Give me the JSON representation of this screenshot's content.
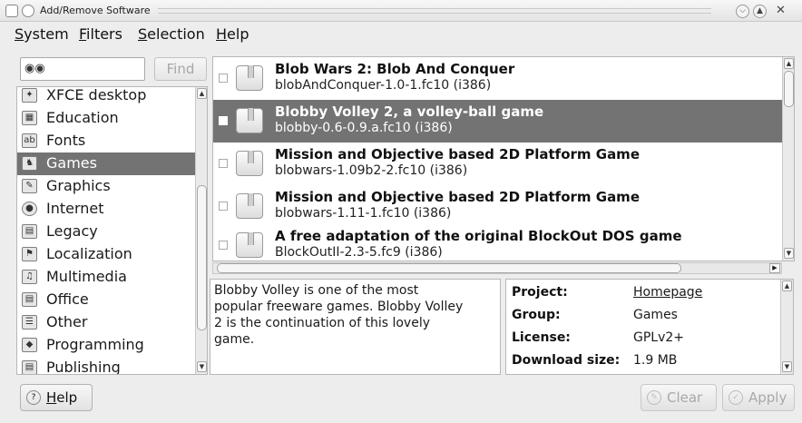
{
  "window": {
    "title": "Add/Remove Software"
  },
  "menubar": {
    "items": [
      {
        "label": "System",
        "mnemonic": "S",
        "rest": "ystem"
      },
      {
        "label": "Filters",
        "mnemonic": "F",
        "rest": "ilters"
      },
      {
        "label": "Selection",
        "mnemonic": "S",
        "rest": "election"
      },
      {
        "label": "Help",
        "mnemonic": "H",
        "rest": "elp"
      }
    ]
  },
  "search": {
    "value": "",
    "find_label": "Find"
  },
  "groups": {
    "items": [
      {
        "label": "XFCE desktop",
        "icon": "mouse-icon"
      },
      {
        "label": "Education",
        "icon": "education-icon"
      },
      {
        "label": "Fonts",
        "icon": "fonts-icon"
      },
      {
        "label": "Games",
        "icon": "games-icon",
        "selected": true
      },
      {
        "label": "Graphics",
        "icon": "graphics-icon"
      },
      {
        "label": "Internet",
        "icon": "internet-icon"
      },
      {
        "label": "Legacy",
        "icon": "legacy-icon"
      },
      {
        "label": "Localization",
        "icon": "flag-icon"
      },
      {
        "label": "Multimedia",
        "icon": "multimedia-icon"
      },
      {
        "label": "Office",
        "icon": "office-icon"
      },
      {
        "label": "Other",
        "icon": "other-icon"
      },
      {
        "label": "Programming",
        "icon": "programming-icon"
      },
      {
        "label": "Publishing",
        "icon": "publishing-icon"
      }
    ]
  },
  "packages": [
    {
      "name": "Blob Wars 2: Blob And Conquer",
      "version": "blobAndConquer-1.0-1.fc10 (i386)",
      "selected": false
    },
    {
      "name": "Blobby Volley 2, a volley-ball game",
      "version": "blobby-0.6-0.9.a.fc10 (i386)",
      "selected": true
    },
    {
      "name": "Mission and Objective based 2D Platform Game",
      "version": "blobwars-1.09b2-2.fc10 (i386)",
      "selected": false
    },
    {
      "name": "Mission and Objective based 2D Platform Game",
      "version": "blobwars-1.11-1.fc10 (i386)",
      "selected": false
    },
    {
      "name": "A free adaptation of the original BlockOut DOS game",
      "version": "BlockOutII-2.3-5.fc9 (i386)",
      "selected": false
    }
  ],
  "description": {
    "lines": [
      "Blobby Volley is one of the most",
      "popular freeware games. Blobby Volley",
      "2 is the continuation of this lovely",
      "game."
    ]
  },
  "details": {
    "project_label": "Project:",
    "project_value": "Homepage",
    "group_label": "Group:",
    "group_value": "Games",
    "license_label": "License:",
    "license_value": "GPLv2+",
    "size_label": "Download size:",
    "size_value": "1.9 MB"
  },
  "buttons": {
    "help": "Help",
    "help_mnemonic": "H",
    "help_rest": "elp",
    "clear": "Clear",
    "apply": "Apply"
  }
}
